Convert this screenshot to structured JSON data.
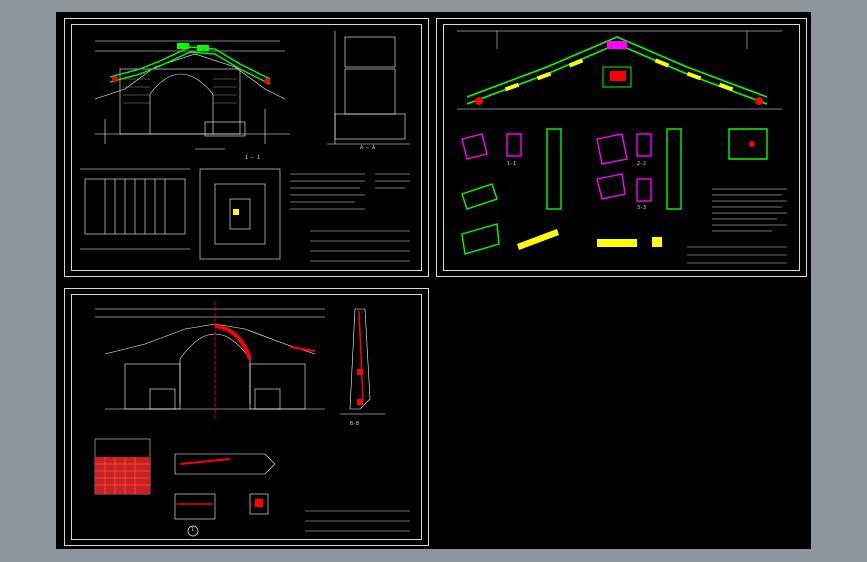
{
  "viewer": {
    "background": "#8e969d",
    "canvas_color": "#000000"
  },
  "sheets": [
    {
      "id": "sheet-1",
      "title": "Bridge elevation, plan and sections",
      "layer_colors": [
        "#ffffff",
        "#00ff00",
        "#ff00ff",
        "#ff0000",
        "#ffff00",
        "#00ffff"
      ]
    },
    {
      "id": "sheet-2",
      "title": "Railing and balustrade details",
      "layer_colors": [
        "#ffffff",
        "#00ff00",
        "#ff00ff",
        "#ff0000",
        "#ffff00",
        "#00ffff"
      ]
    },
    {
      "id": "sheet-3",
      "title": "Arch reinforcement details",
      "layer_colors": [
        "#ffffff",
        "#ff0000",
        "#00ffff",
        "#ffff00"
      ]
    }
  ],
  "labels": {
    "section_1_1": "1 — 1",
    "section_a_a": "A — A",
    "label_11": "1-1",
    "label_22": "2-2",
    "label_33": "3-3",
    "label_bb": "B-B",
    "circle_mark": "1"
  }
}
